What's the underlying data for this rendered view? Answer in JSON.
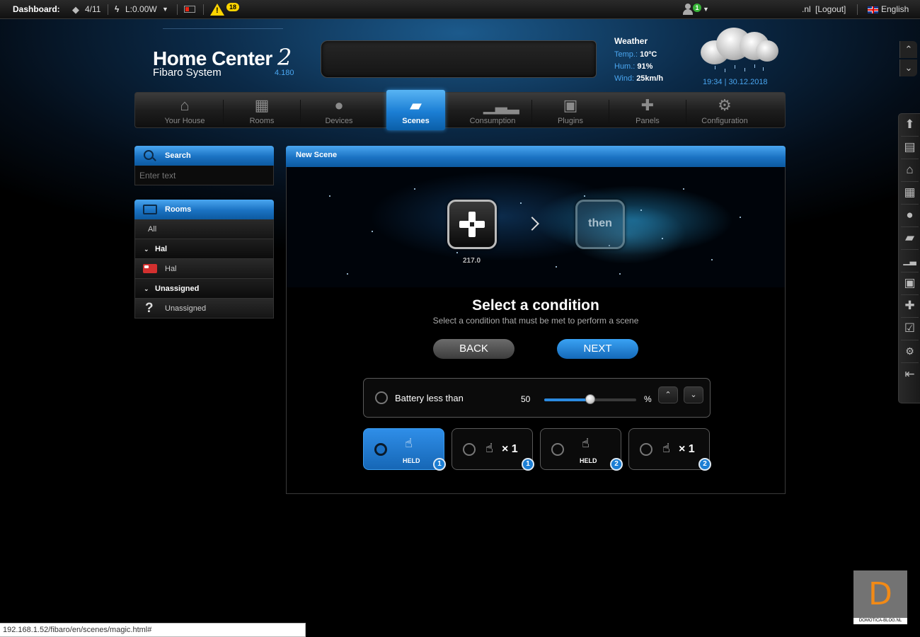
{
  "topbar": {
    "dashboard_label": "Dashboard:",
    "devices_count": "4/11",
    "power": "L:0.00W",
    "warnings": "18",
    "user_badge": "1",
    "user_domain": ".nl",
    "logout": "[Logout]",
    "language": "English"
  },
  "header": {
    "title": "Home Center",
    "title_number": "2",
    "subtitle": "Fibaro System",
    "version": "4.180"
  },
  "weather": {
    "title": "Weather",
    "temp_label": "Temp.:",
    "temp_value": "10ºC",
    "hum_label": "Hum.:",
    "hum_value": "91%",
    "wind_label": "Wind:",
    "wind_value": "25km/h",
    "datetime": "19:34 | 30.12.2018"
  },
  "nav": {
    "tabs": [
      {
        "label": "Your House",
        "icon": "house-icon"
      },
      {
        "label": "Rooms",
        "icon": "rooms-icon"
      },
      {
        "label": "Devices",
        "icon": "bulb-icon"
      },
      {
        "label": "Scenes",
        "icon": "clapper-icon"
      },
      {
        "label": "Consumption",
        "icon": "chart-icon"
      },
      {
        "label": "Plugins",
        "icon": "box-icon"
      },
      {
        "label": "Panels",
        "icon": "puzzle-icon"
      },
      {
        "label": "Configuration",
        "icon": "gear-icon"
      }
    ],
    "active": "Scenes"
  },
  "sidebar": {
    "search_title": "Search",
    "search_placeholder": "Enter text",
    "rooms_title": "Rooms",
    "items": [
      {
        "label": "All",
        "type": "item"
      },
      {
        "label": "Hal",
        "type": "group"
      },
      {
        "label": "Hal",
        "type": "room"
      },
      {
        "label": "Unassigned",
        "type": "group"
      },
      {
        "label": "Unassigned",
        "type": "room"
      }
    ]
  },
  "scene": {
    "panel_title": "New Scene",
    "step1_label": "217.0",
    "step2_label": "then",
    "title": "Select a condition",
    "subtitle": "Select a condition that must be met to perform a scene",
    "back": "BACK",
    "next": "NEXT",
    "condition": {
      "label": "Battery less than",
      "value": "50",
      "unit": "%",
      "level_percent": 50
    },
    "options": [
      {
        "label": "HELD",
        "badge": "1",
        "selected": true
      },
      {
        "label": "× 1",
        "badge": "1",
        "selected": false
      },
      {
        "label": "HELD",
        "badge": "2",
        "selected": false
      },
      {
        "label": "× 1",
        "badge": "2",
        "selected": false
      }
    ]
  },
  "status_url": "192.168.1.52/fibaro/en/scenes/magic.html#",
  "watermark": {
    "letter": "D",
    "text": "DOMOTICA-BLOG.NL"
  },
  "colors": {
    "accent": "#1b7ed4",
    "warning": "#ffd400",
    "brand_orange": "#f28a16"
  }
}
